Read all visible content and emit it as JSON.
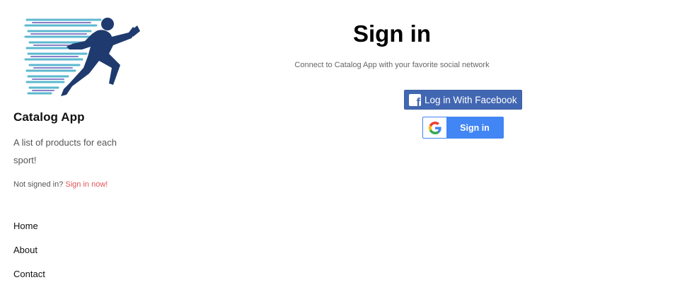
{
  "sidebar": {
    "app_title": "Catalog App",
    "tagline": "A list of products for each sport!",
    "signin_status": {
      "prefix": "Not signed in?",
      "link": "Sign in now!"
    },
    "nav": [
      {
        "label": "Home"
      },
      {
        "label": "About"
      },
      {
        "label": "Contact"
      }
    ]
  },
  "main": {
    "title": "Sign in",
    "subtitle": "Connect to Catalog App with your favorite social network",
    "facebook_button": {
      "label": "Log in With Facebook",
      "icon": "facebook-icon"
    },
    "google_button": {
      "label": "Sign in",
      "icon": "google-icon"
    }
  },
  "colors": {
    "facebook": "#4267b2",
    "google": "#4285f4",
    "link": "#e0555a",
    "logo_runner": "#1f3a6e",
    "logo_speed_lines": "#5bb8cf"
  }
}
